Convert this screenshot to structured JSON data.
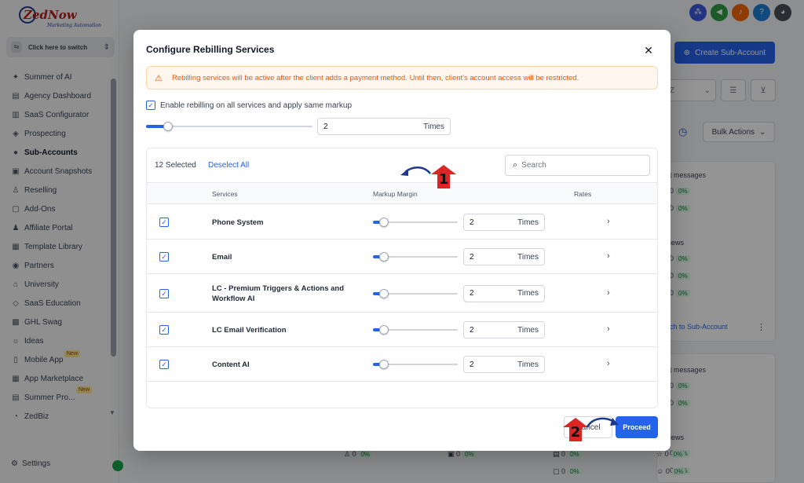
{
  "brand": {
    "logo_text": "ZedNow",
    "logo_subtitle": "Marketing Automation"
  },
  "sidebar": {
    "switcher_label": "Click here to switch",
    "items": [
      {
        "label": "Summer of AI",
        "icon": "sparkle-icon",
        "glyph": "✦"
      },
      {
        "label": "Agency Dashboard",
        "icon": "dashboard-icon",
        "glyph": "▤"
      },
      {
        "label": "SaaS Configurator",
        "icon": "chart-icon",
        "glyph": "▥"
      },
      {
        "label": "Prospecting",
        "icon": "prospecting-icon",
        "glyph": "◈"
      },
      {
        "label": "Sub-Accounts",
        "icon": "user-icon",
        "glyph": "●"
      },
      {
        "label": "Account Snapshots",
        "icon": "snapshot-icon",
        "glyph": "▣"
      },
      {
        "label": "Reselling",
        "icon": "reselling-icon",
        "glyph": "♙"
      },
      {
        "label": "Add-Ons",
        "icon": "addons-icon",
        "glyph": "▢"
      },
      {
        "label": "Affiliate Portal",
        "icon": "affiliate-icon",
        "glyph": "♟"
      },
      {
        "label": "Template Library",
        "icon": "template-icon",
        "glyph": "▦"
      },
      {
        "label": "Partners",
        "icon": "partners-icon",
        "glyph": "◉"
      },
      {
        "label": "University",
        "icon": "university-icon",
        "glyph": "⌂"
      },
      {
        "label": "SaaS Education",
        "icon": "education-icon",
        "glyph": "◇"
      },
      {
        "label": "GHL Swag",
        "icon": "swag-icon",
        "glyph": "▩"
      },
      {
        "label": "Ideas",
        "icon": "idea-icon",
        "glyph": "☼"
      },
      {
        "label": "Mobile App",
        "icon": "mobile-icon",
        "glyph": "▯"
      },
      {
        "label": "App Marketplace",
        "icon": "marketplace-icon",
        "glyph": "▦"
      },
      {
        "label": "Summer Pro...",
        "icon": "summer-icon",
        "glyph": "▤"
      },
      {
        "label": "ZedBiz",
        "icon": "zedbiz-icon",
        "glyph": "◔"
      }
    ],
    "new_badge": "New",
    "settings_label": "Settings"
  },
  "background": {
    "create_button": "Create Sub-Account",
    "filter_value": "Z",
    "bulk_actions": "Bulk Actions",
    "messages_label": "t messages",
    "views_label": "iews",
    "stat_zero": "0",
    "stat_pct": "0%",
    "switch_link": "ch to Sub-Account"
  },
  "modal": {
    "title": "Configure Rebilling Services",
    "alert": "Rebilling services will be active after the client adds a payment method. Until then, client's account access will be restricted.",
    "enable_label": "Enable rebilling on all services and apply same markup",
    "global_markup": {
      "value": "2",
      "unit": "Times",
      "slider_fraction": 0.13
    },
    "selected_count": "12 Selected",
    "deselect_all": "Deselect All",
    "search_placeholder": "Search",
    "columns": {
      "services": "Services",
      "markup": "Markup Margin",
      "rates": "Rates"
    },
    "rows": [
      {
        "service": "Phone System",
        "value": "2",
        "unit": "Times",
        "slider_fraction": 0.13
      },
      {
        "service": "Email",
        "value": "2",
        "unit": "Times",
        "slider_fraction": 0.13
      },
      {
        "service": "LC - Premium Triggers & Actions and Workflow AI",
        "value": "2",
        "unit": "Times",
        "slider_fraction": 0.13
      },
      {
        "service": "LC Email Verification",
        "value": "2",
        "unit": "Times",
        "slider_fraction": 0.13
      },
      {
        "service": "Content AI",
        "value": "2",
        "unit": "Times",
        "slider_fraction": 0.13
      }
    ],
    "cancel_label": "Cancel",
    "proceed_label": "Proceed"
  },
  "annotations": {
    "marker_1": "1",
    "marker_2": "2"
  },
  "colors": {
    "accent": "#2563eb",
    "alert_text": "#ea580c",
    "alert_bg": "#fff7ed",
    "annotation_red": "#dc2626"
  }
}
